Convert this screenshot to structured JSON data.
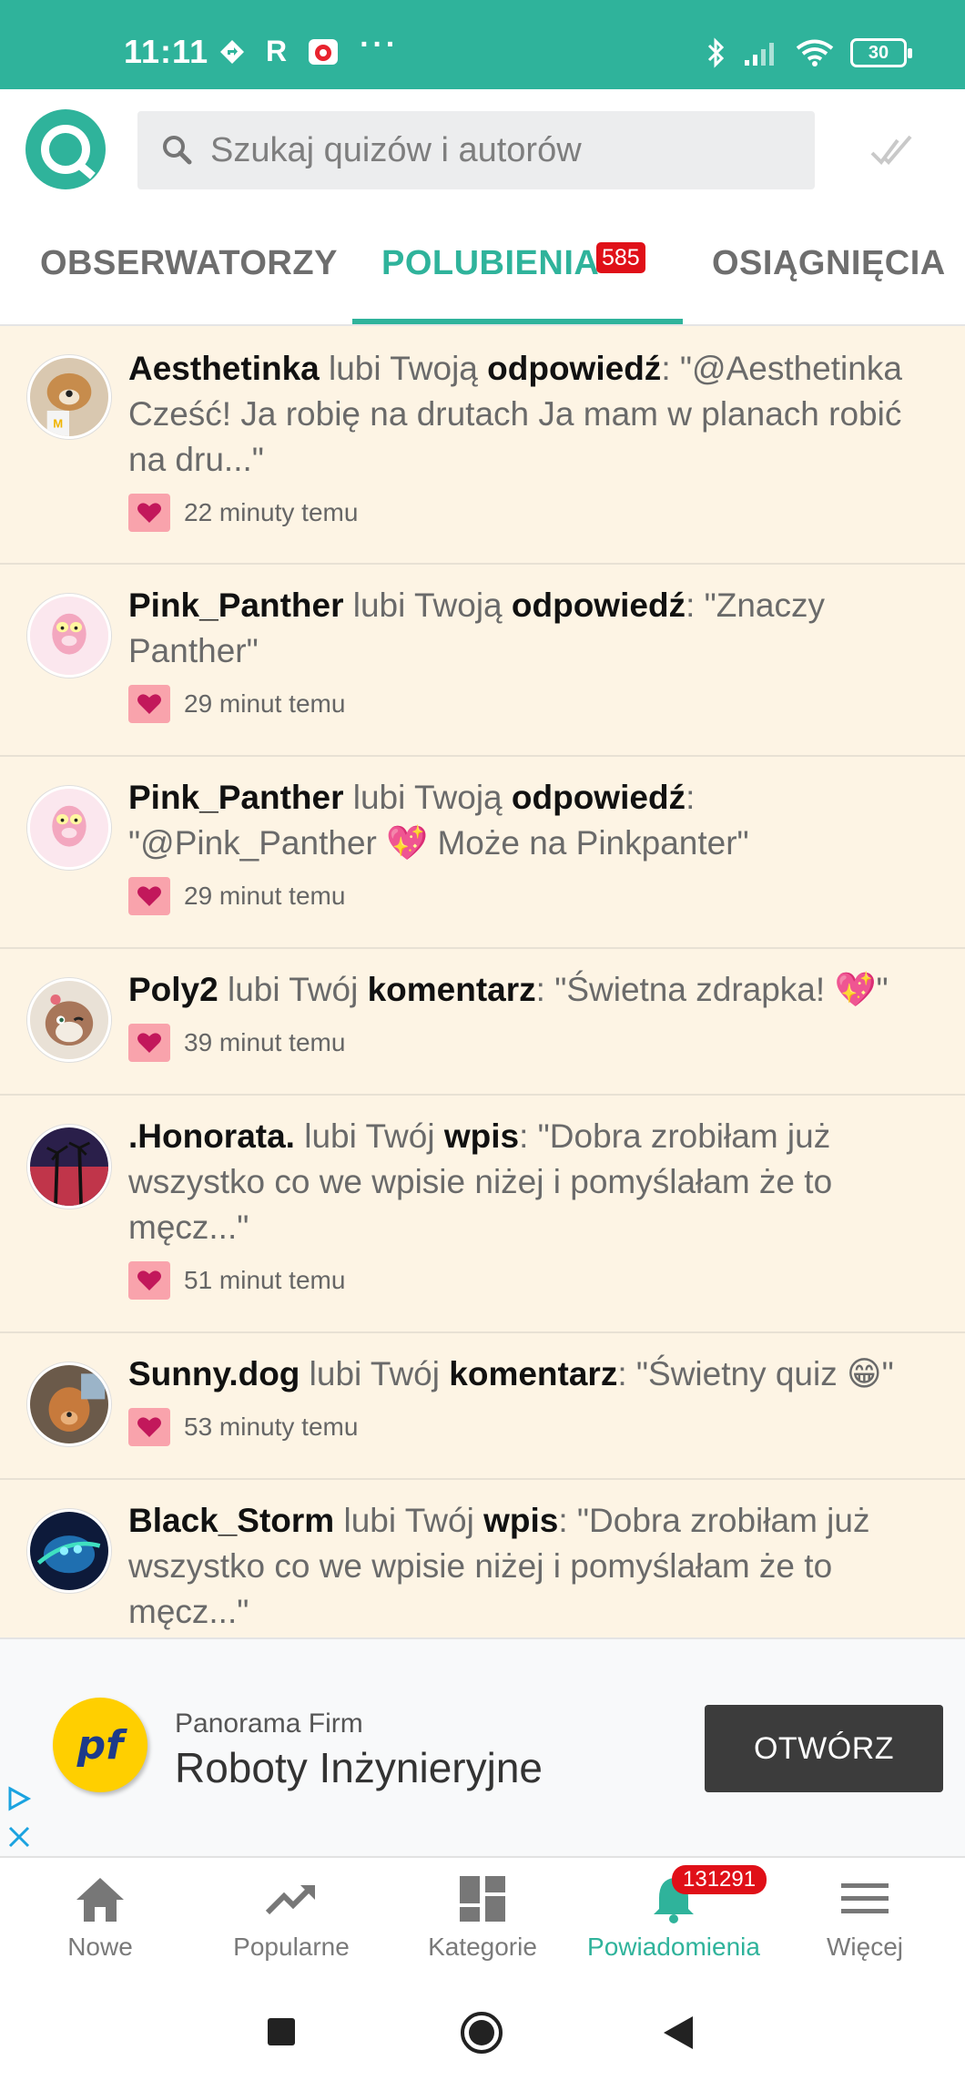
{
  "status_bar": {
    "time": "11:11",
    "r_label": "R",
    "dots": "···",
    "battery": "30"
  },
  "header": {
    "search_placeholder": "Szukaj quizów i autorów"
  },
  "tabs": [
    {
      "label": "OBSERWATORZY"
    },
    {
      "label": "POLUBIENIA",
      "badge": "585"
    },
    {
      "label": "OSIĄGNIĘCIA"
    }
  ],
  "active_tab": "POLUBIENIA",
  "notifications": [
    {
      "user": "Aesthetinka",
      "verb": " lubi Twoją ",
      "object": "odpowiedź",
      "text": ": \"@Aesthetinka Cześć! Ja robię na drutach Ja mam w planach robić na dru...\"",
      "time": "22 minuty temu"
    },
    {
      "user": "Pink_Panther",
      "verb": " lubi Twoją ",
      "object": "odpowiedź",
      "text": ": \"Znaczy Panther\"",
      "time": "29 minut temu"
    },
    {
      "user": "Pink_Panther",
      "verb": " lubi Twoją ",
      "object": "odpowiedź",
      "text": ": \"@Pink_Panther 💖 Może na Pinkpanter\"",
      "time": "29 minut temu"
    },
    {
      "user": "Poly2",
      "verb": " lubi Twój ",
      "object": "komentarz",
      "text": ": \"Świetna zdrapka! 💖\"",
      "time": "39 minut temu"
    },
    {
      "user": ".Honorata.",
      "verb": " lubi Twój ",
      "object": "wpis",
      "text": ": \"Dobra zrobiłam już wszystko co we wpisie niżej i pomyślałam że to męcz...\"",
      "time": "51 minut temu"
    },
    {
      "user": "Sunny.dog",
      "verb": " lubi Twój ",
      "object": "komentarz",
      "text": ": \"Świetny quiz 😁\"",
      "time": "53 minuty temu"
    },
    {
      "user": "Black_Storm",
      "verb": " lubi Twój ",
      "object": "wpis",
      "text": ": \"Dobra zrobiłam już wszystko co we wpisie niżej i pomyślałam że to męcz...\"",
      "time": ""
    }
  ],
  "ad": {
    "brand": "Panorama Firm",
    "title": "Roboty Inżynieryjne",
    "button": "OTWÓRZ",
    "logo_text": "pf"
  },
  "bottom_nav": [
    {
      "label": "Nowe",
      "icon": "home-icon"
    },
    {
      "label": "Popularne",
      "icon": "trending-icon"
    },
    {
      "label": "Kategorie",
      "icon": "grid-icon"
    },
    {
      "label": "Powiadomienia",
      "icon": "bell-icon",
      "badge": "131291",
      "active": true
    },
    {
      "label": "Więcej",
      "icon": "menu-icon"
    }
  ],
  "colors": {
    "accent": "#2fb39b",
    "badge": "#e01018",
    "feed_bg": "#fdf4e4",
    "heart": "#c2185b"
  }
}
